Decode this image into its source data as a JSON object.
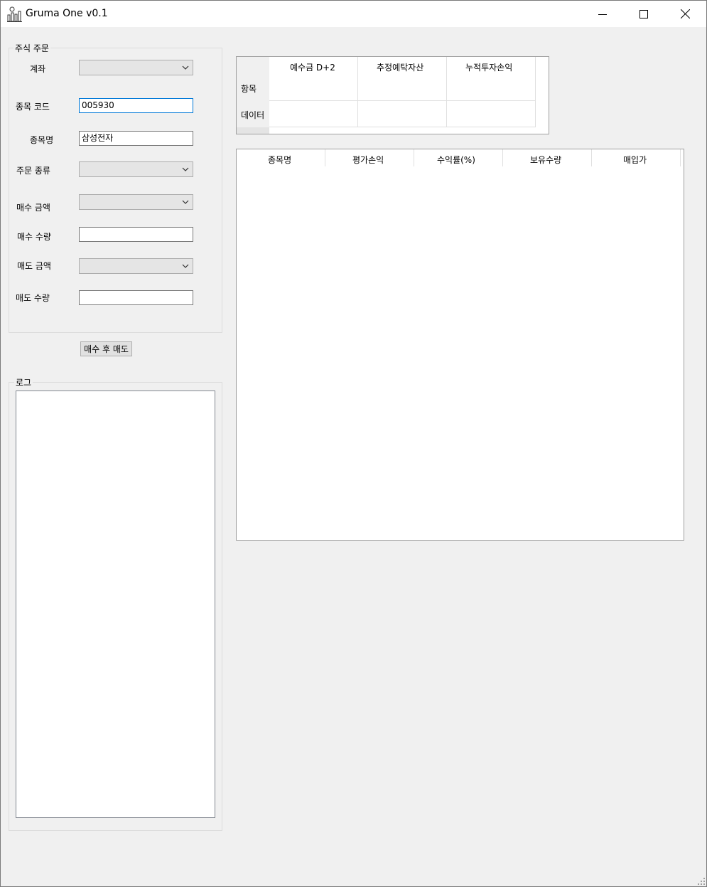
{
  "window": {
    "title": "Gruma One v0.1"
  },
  "order_group": {
    "legend": "주식 주문",
    "account_label": "계좌",
    "code_label": "종목 코드",
    "code_value": "005930",
    "name_label": "종목명",
    "name_value": "삼성전자",
    "order_type_label": "주문 종류",
    "buy_price_label": "매수 금액",
    "buy_qty_label": "매수 수량",
    "sell_price_label": "매도 금액",
    "sell_qty_label": "매도 수량"
  },
  "action_button": {
    "label": "매수 후 매도"
  },
  "log_group": {
    "legend": "로그"
  },
  "summary_grid": {
    "columns": [
      "예수금 D+2",
      "추정예탁자산",
      "누적투자손익"
    ],
    "rows": [
      "항목",
      "데이터"
    ]
  },
  "holdings_grid": {
    "columns": [
      "종목명",
      "평가손익",
      "수익률(%)",
      "보유수량",
      "매입가"
    ]
  },
  "icons": {
    "app": "chart-bars-icon",
    "minimize": "minimize-icon",
    "maximize": "maximize-icon",
    "close": "close-icon",
    "dropdown": "chevron-down-icon",
    "resize": "resize-grip-icon"
  }
}
